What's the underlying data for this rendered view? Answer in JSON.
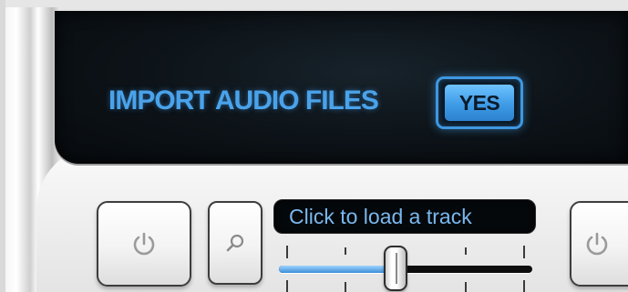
{
  "screen": {
    "import_label": "IMPORT AUDIO FILES",
    "yes_button_label": "YES",
    "accent_color": "#4aa3ea"
  },
  "left_deck": {
    "power_icon": "power-icon",
    "search_icon": "search-icon",
    "track_display_text": "Click to load a track",
    "slider_value_fraction": 0.46
  },
  "right_deck": {
    "power_icon": "power-icon"
  }
}
